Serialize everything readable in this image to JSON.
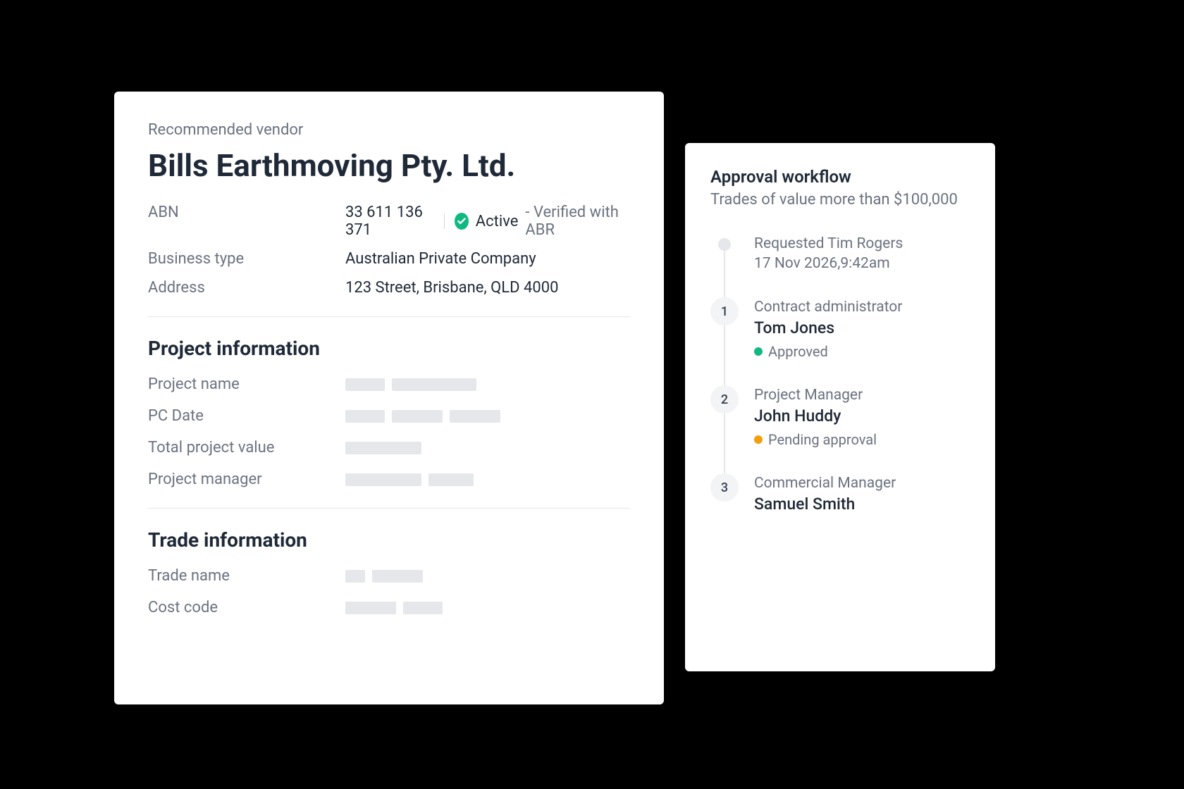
{
  "vendor": {
    "subtitle": "Recommended vendor",
    "name": "Bills Earthmoving Pty. Ltd.",
    "abn_label": "ABN",
    "abn_value": "33 611 136 371",
    "status": "Active",
    "verified": "- Verified with ABR",
    "business_type_label": "Business type",
    "business_type_value": "Australian Private Company",
    "address_label": "Address",
    "address_value": "123 Street, Brisbane, QLD 4000"
  },
  "project": {
    "section_title": "Project information",
    "name_label": "Project name",
    "pc_date_label": "PC Date",
    "total_value_label": "Total project value",
    "manager_label": "Project manager"
  },
  "trade": {
    "section_title": "Trade information",
    "name_label": "Trade name",
    "cost_code_label": "Cost code"
  },
  "workflow": {
    "title": "Approval workflow",
    "subtitle": "Trades of value more than $100,000",
    "requested_label": "Requested Tim Rogers",
    "requested_time": "17 Nov 2026,9:42am",
    "steps": [
      {
        "num": "1",
        "role": "Contract administrator",
        "name": "Tom Jones",
        "status": "Approved",
        "status_color": "green"
      },
      {
        "num": "2",
        "role": "Project Manager",
        "name": "John Huddy",
        "status": "Pending approval",
        "status_color": "orange"
      },
      {
        "num": "3",
        "role": "Commercial Manager",
        "name": "Samuel Smith"
      }
    ]
  }
}
